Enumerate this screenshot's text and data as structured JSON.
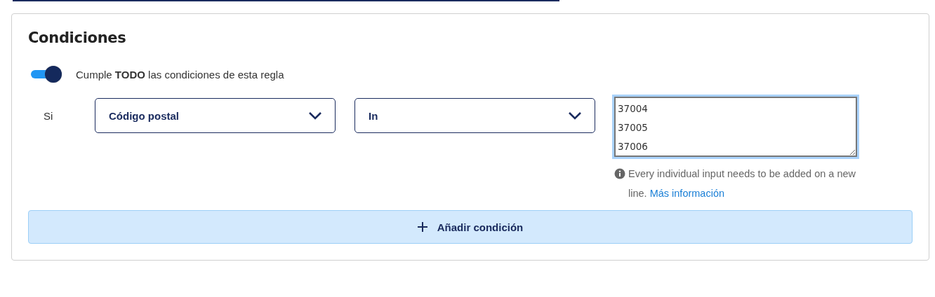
{
  "title": "Condiciones",
  "match_all": {
    "on": true,
    "label": "Cumple **TODO** las condiciones de esta regla"
  },
  "conditions": [
    {
      "prefix": "Si",
      "field": "Código postal",
      "operator": "In",
      "values": "37004\n37005\n37006",
      "focused": true,
      "help": "Every individual input needs to be added on a new line.",
      "help_link": "Más información"
    }
  ],
  "add_button": {
    "label": "Añadir condición"
  }
}
